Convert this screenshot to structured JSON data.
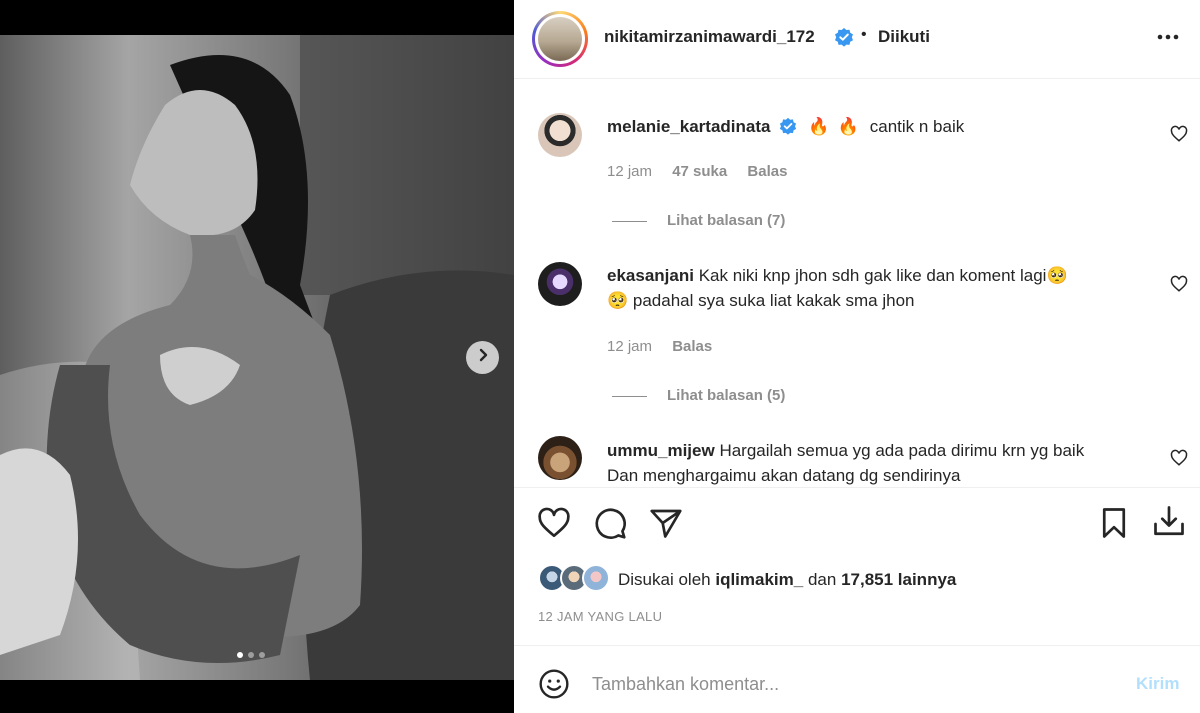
{
  "media": {
    "image_name": "post-photo",
    "carousel_dots": 3,
    "active_dot": 0,
    "next_icon": "chevron-right-icon"
  },
  "header": {
    "username": "nikitamirzanimawardi_172",
    "verified_icon": "verified-badge-icon",
    "bullet": "•",
    "follow_state": "Diikuti",
    "more_icon": "more-horizontal-icon"
  },
  "comments": [
    {
      "username": "melanie_kartadinata",
      "verified": true,
      "emojis": [
        "🔥",
        "🔥"
      ],
      "text": "cantik n baik",
      "time": "12 jam",
      "likes": "47 suka",
      "reply": "Balas",
      "replies": "Lihat balasan (7)"
    },
    {
      "username": "ekasanjani",
      "verified": false,
      "text_line1": "Kak niki knp jhon sdh gak like dan koment lagi🥺",
      "text_line2": "🥺 padahal sya suka liat kakak sma jhon",
      "time": "12 jam",
      "reply": "Balas",
      "replies": "Lihat balasan (5)"
    },
    {
      "username": "ummu_mijew",
      "verified": false,
      "text_line1": "Hargailah semua yg ada pada dirimu krn yg baik",
      "text_line2": "Dan menghargaimu akan datang dg sendirinya"
    }
  ],
  "actions": {
    "like_icon": "heart-icon",
    "comment_icon": "comment-icon",
    "share_icon": "send-icon",
    "save_icon": "bookmark-icon",
    "download_icon": "download-icon"
  },
  "likes": {
    "prefix": "Disukai oleh",
    "user": "iqlimakim_",
    "middle": "dan",
    "count": "17,851 lainnya"
  },
  "post_time": "12 JAM YANG LALU",
  "add_comment": {
    "emoji_icon": "smiley-icon",
    "placeholder": "Tambahkan komentar...",
    "post_label": "Kirim"
  },
  "colors": {
    "link_disabled": "#b2dffc",
    "verified": "#3897f0",
    "muted": "#8e8e8e"
  }
}
